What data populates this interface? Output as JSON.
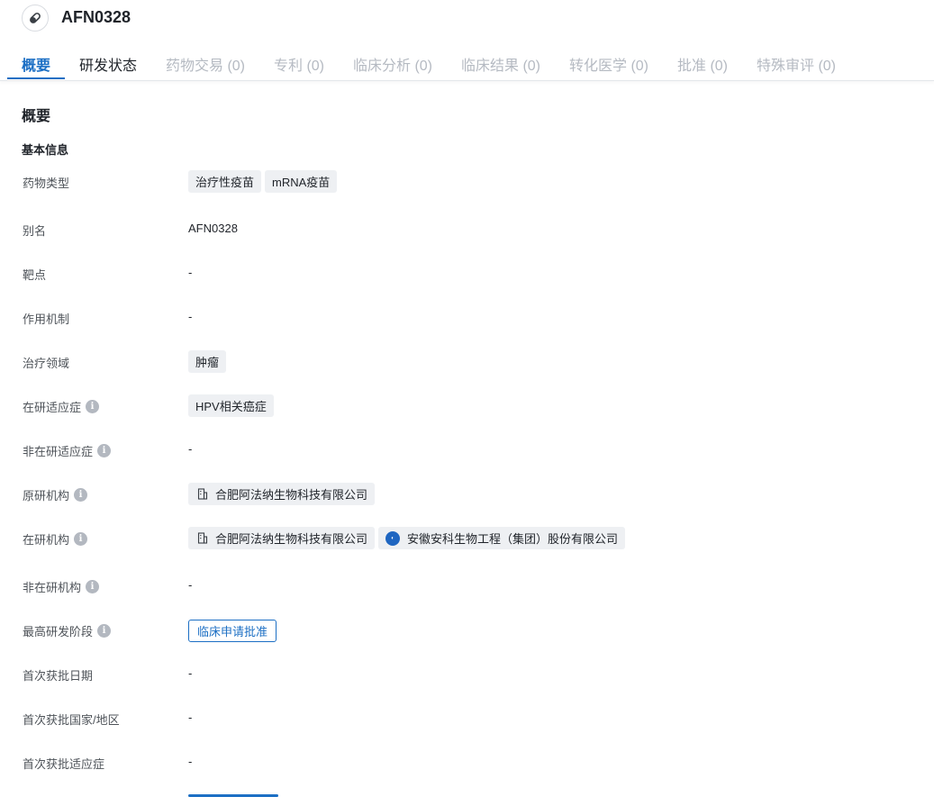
{
  "header": {
    "title": "AFN0328",
    "icon": "pill-icon"
  },
  "tabs": [
    {
      "label": "概要",
      "state": "active"
    },
    {
      "label": "研发状态",
      "state": "normal"
    },
    {
      "label": "药物交易 (0)",
      "state": "disabled"
    },
    {
      "label": "专利 (0)",
      "state": "disabled"
    },
    {
      "label": "临床分析 (0)",
      "state": "disabled"
    },
    {
      "label": "临床结果 (0)",
      "state": "disabled"
    },
    {
      "label": "转化医学 (0)",
      "state": "disabled"
    },
    {
      "label": "批准 (0)",
      "state": "disabled"
    },
    {
      "label": "特殊审评 (0)",
      "state": "disabled"
    }
  ],
  "section_title": "概要",
  "sub_title": "基本信息",
  "rows": {
    "drug_type": {
      "label": "药物类型",
      "tags": [
        "治疗性疫苗",
        "mRNA疫苗"
      ]
    },
    "alias": {
      "label": "别名",
      "value": "AFN0328"
    },
    "target": {
      "label": "靶点",
      "value": "-"
    },
    "mechanism": {
      "label": "作用机制",
      "value": "-"
    },
    "therapeutic_area": {
      "label": "治疗领域",
      "tags": [
        "肿瘤"
      ]
    },
    "active_indication": {
      "label": "在研适应症",
      "tags": [
        "HPV相关癌症"
      ]
    },
    "inactive_indication": {
      "label": "非在研适应症",
      "value": "-"
    },
    "originator": {
      "label": "原研机构",
      "orgs": [
        "合肥阿法纳生物科技有限公司"
      ]
    },
    "active_org": {
      "label": "在研机构",
      "orgs": [
        "合肥阿法纳生物科技有限公司",
        "安徽安科生物工程（集团）股份有限公司"
      ]
    },
    "inactive_org": {
      "label": "非在研机构",
      "value": "-"
    },
    "highest_phase": {
      "label": "最高研发阶段",
      "stage": "临床申请批准"
    },
    "first_approval_date": {
      "label": "首次获批日期",
      "value": "-"
    },
    "first_approval_country": {
      "label": "首次获批国家/地区",
      "value": "-"
    },
    "first_approval_indication": {
      "label": "首次获批适应症",
      "value": "-"
    }
  },
  "colors": {
    "accent": "#1c6fc4",
    "tag_bg": "#eef0f3",
    "muted_tab": "#b5bac2"
  }
}
